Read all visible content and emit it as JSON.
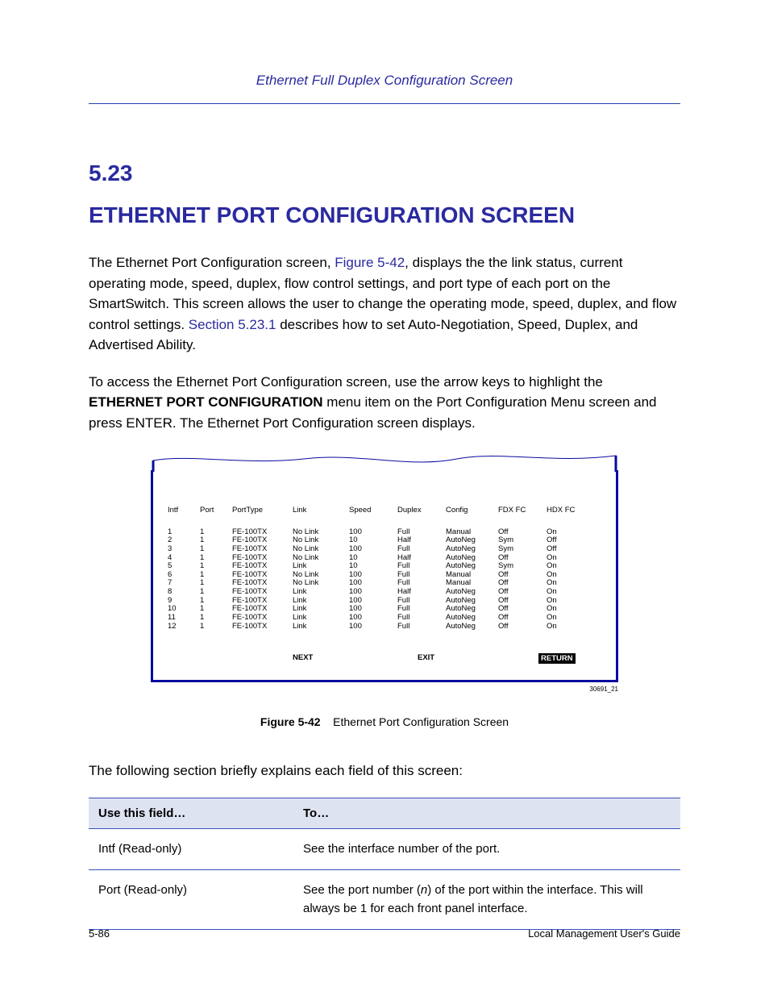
{
  "spread_title": "Ethernet Full Duplex Configuration Screen",
  "section": {
    "number": "5.23",
    "title": "ETHERNET PORT CONFIGURATION SCREEN"
  },
  "bodytext": {
    "p1_pre": "The Ethernet Port Configuration screen, ",
    "p1_link": "Figure 5-42",
    "p1_post": ", displays the the link status, current operating mode, speed, duplex, flow control settings, and port type of each port on the SmartSwitch. This screen allows the user to change the operating mode, speed, duplex, and flow control settings. ",
    "p1_link2": "Section 5.23.1",
    "p1_tail": " describes how to set Auto-Negotiation, Speed, Duplex, and Advertised Ability.",
    "p2_pre": "To access the Ethernet Port Configuration screen, use the arrow keys to highlight the ",
    "p2_bold": "ETHERNET PORT CONFIGURATION",
    "p2_post": " menu item on the Port Configuration Menu screen and press ENTER. The Ethernet Port Configuration screen displays."
  },
  "terminal": {
    "headers": [
      "Intf",
      "Port",
      "PortType",
      "Link",
      "Speed",
      "Duplex",
      "Config",
      "FDX FC",
      "HDX FC"
    ],
    "rows": [
      [
        "1",
        "1",
        "FE-100TX",
        "No Link",
        "100",
        "Full",
        "Manual",
        "Off",
        "On"
      ],
      [
        "2",
        "1",
        "FE-100TX",
        "No Link",
        "10",
        "Half",
        "AutoNeg",
        "Sym",
        "Off"
      ],
      [
        "3",
        "1",
        "FE-100TX",
        "No Link",
        "100",
        "Full",
        "AutoNeg",
        "Sym",
        "Off"
      ],
      [
        "4",
        "1",
        "FE-100TX",
        "No Link",
        "10",
        "Half",
        "AutoNeg",
        "Off",
        "On"
      ],
      [
        "5",
        "1",
        "FE-100TX",
        "Link",
        "10",
        "Full",
        "AutoNeg",
        "Sym",
        "On"
      ],
      [
        "6",
        "1",
        "FE-100TX",
        "No Link",
        "100",
        "Full",
        "Manual",
        "Off",
        "On"
      ],
      [
        "7",
        "1",
        "FE-100TX",
        "No Link",
        "100",
        "Full",
        "Manual",
        "Off",
        "On"
      ],
      [
        "8",
        "1",
        "FE-100TX",
        "Link",
        "100",
        "Half",
        "AutoNeg",
        "Off",
        "On"
      ],
      [
        "9",
        "1",
        "FE-100TX",
        "Link",
        "100",
        "Full",
        "AutoNeg",
        "Off",
        "On"
      ],
      [
        "10",
        "1",
        "FE-100TX",
        "Link",
        "100",
        "Full",
        "AutoNeg",
        "Off",
        "On"
      ],
      [
        "11",
        "1",
        "FE-100TX",
        "Link",
        "100",
        "Full",
        "AutoNeg",
        "Off",
        "On"
      ],
      [
        "12",
        "1",
        "FE-100TX",
        "Link",
        "100",
        "Full",
        "AutoNeg",
        "Off",
        "On"
      ]
    ],
    "footer": {
      "next": "NEXT",
      "exit": "EXIT",
      "return": "RETURN"
    }
  },
  "figure": {
    "number_small": "30691_21",
    "caption_num": "Figure 5-42",
    "caption_text": "Ethernet Port Configuration Screen"
  },
  "body_after": "The following section briefly explains each field of this screen:",
  "desc_table": {
    "headers": [
      "Use this field…",
      "To…"
    ],
    "rows": [
      {
        "use": "Intf (Read-only)",
        "to": "See the interface number of the port."
      },
      {
        "use": "Port (Read-only)",
        "to_pre": "See the port number (",
        "to_em": "n",
        "to_post": ") of the port within the interface. This will always be 1 for each front panel interface."
      }
    ]
  },
  "footer": {
    "left": "5-86",
    "right": "Local Management User's Guide"
  }
}
